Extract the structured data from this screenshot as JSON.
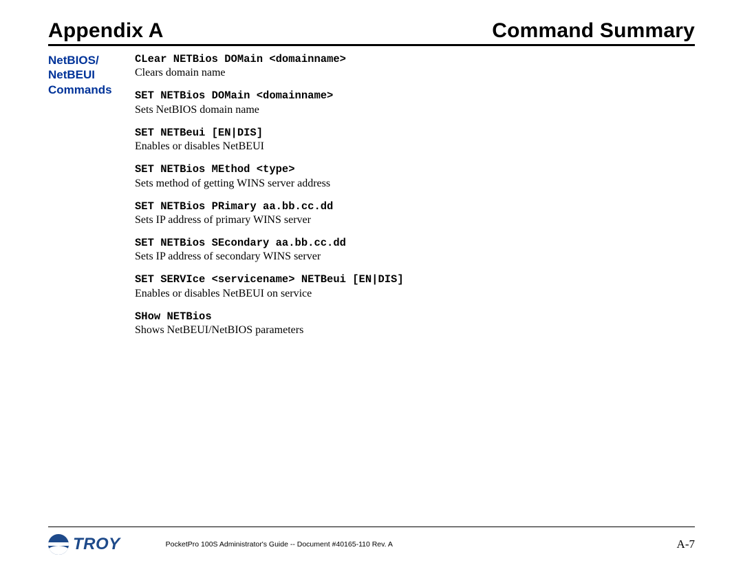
{
  "header": {
    "left": "Appendix A",
    "right": "Command Summary"
  },
  "sidehead": {
    "line1": "NetBIOS/",
    "line2": "NetBEUI",
    "line3": "Commands"
  },
  "commands": [
    {
      "code": "CLear NETBios DOMain <domainname>",
      "desc": "Clears domain name"
    },
    {
      "code": "SET NETBios DOMain <domainname>",
      "desc": "Sets NetBIOS domain name"
    },
    {
      "code": "SET NETBeui [EN|DIS]",
      "desc": "Enables or disables NetBEUI"
    },
    {
      "code": "SET NETBios MEthod <type>",
      "desc": "Sets method of getting WINS server address"
    },
    {
      "code": "SET NETBios PRimary aa.bb.cc.dd",
      "desc": "Sets IP address of primary WINS server"
    },
    {
      "code": "SET NETBios SEcondary aa.bb.cc.dd",
      "desc": "Sets IP address of secondary WINS server"
    },
    {
      "code": "SET SERVIce <servicename> NETBeui [EN|DIS]",
      "desc": "Enables or disables NetBEUI on service"
    },
    {
      "code": "SHow NETBios",
      "desc": "Shows NetBEUI/NetBIOS parameters"
    }
  ],
  "footer": {
    "logo_text": "TROY",
    "doc": "PocketPro 100S Administrator's Guide -- Document #40165-110  Rev. A",
    "page": "A-7"
  }
}
